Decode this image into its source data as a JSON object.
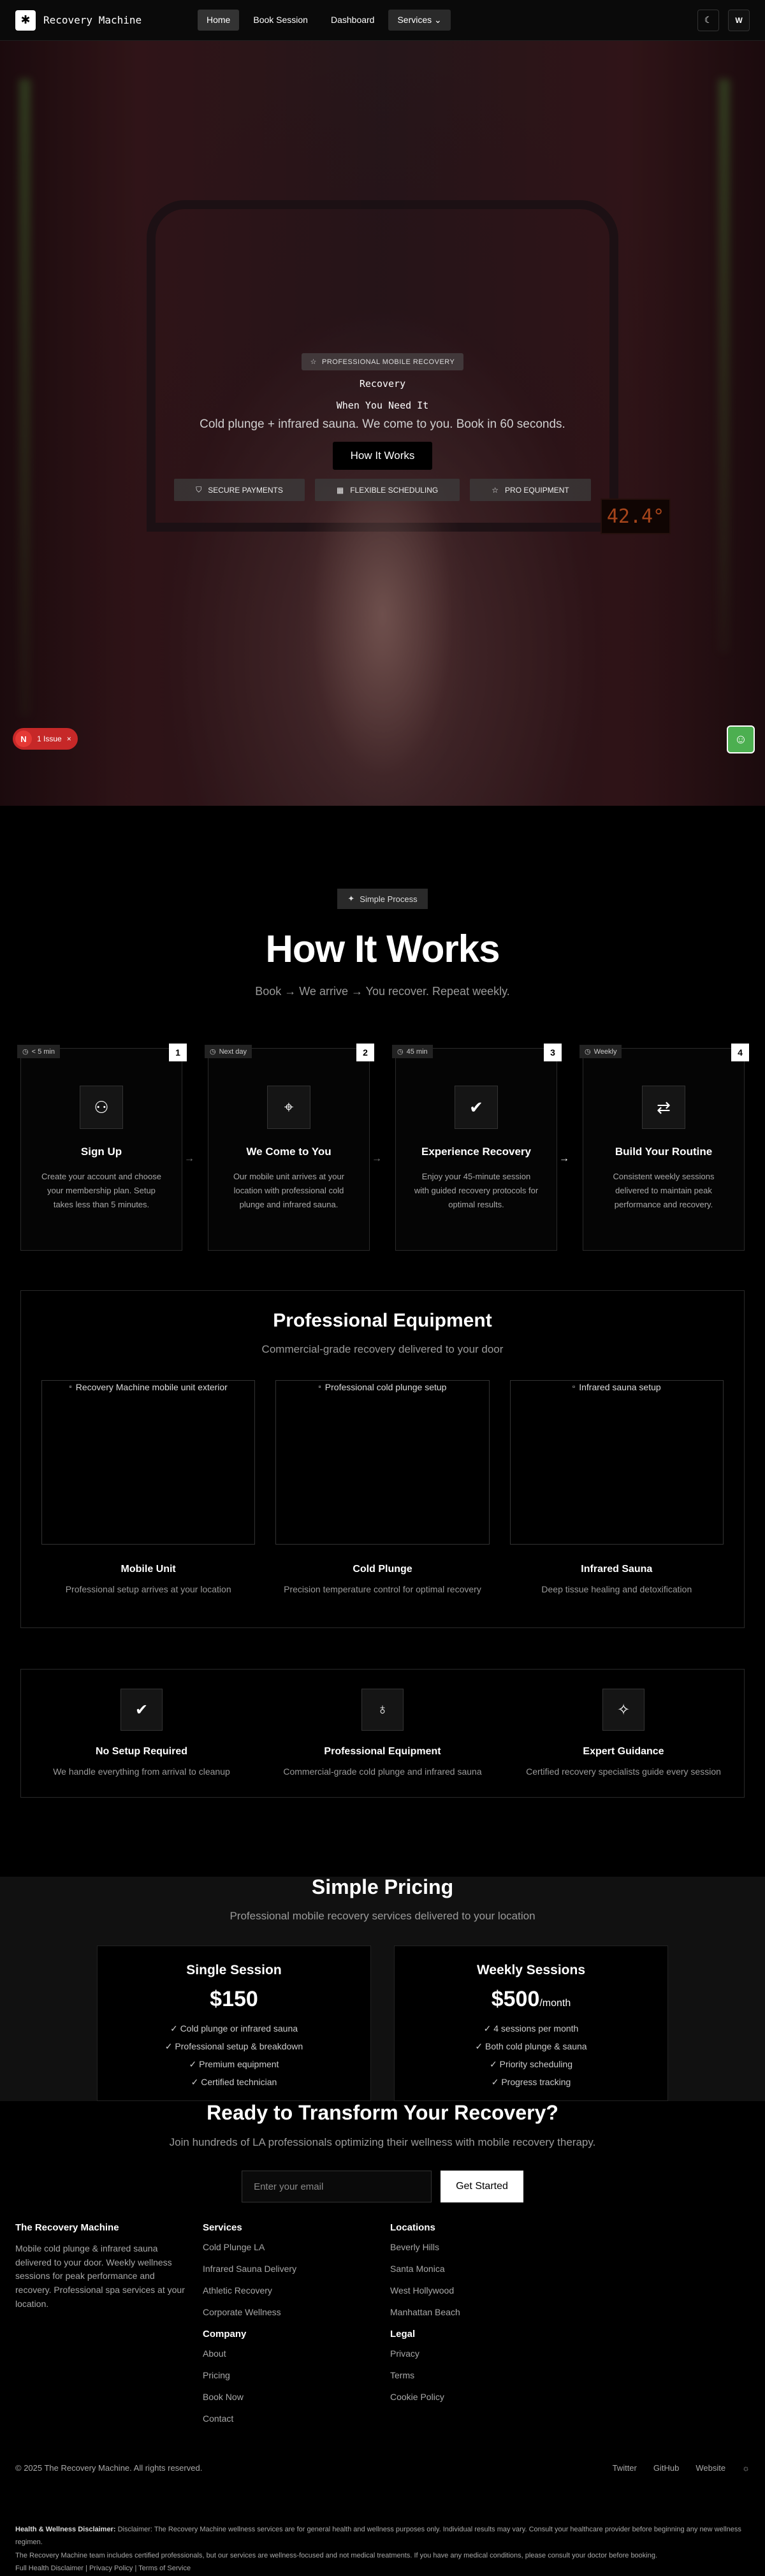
{
  "nav": {
    "brand": "Recovery Machine",
    "links": [
      "Home",
      "Book Session",
      "Dashboard"
    ],
    "services": "Services ⌄",
    "theme_icon": "moon-icon",
    "avatar": "W"
  },
  "hero": {
    "badge": "PROFESSIONAL MOBILE RECOVERY",
    "title": "Recovery",
    "subtitle": "When You Need It",
    "description": "Cold plunge + infrared sauna. We come to you. Book in 60 seconds.",
    "cta": "How It Works",
    "features": [
      "SECURE PAYMENTS",
      "FLEXIBLE SCHEDULING",
      "PRO EQUIPMENT"
    ],
    "thermo": "42.4°"
  },
  "issues": {
    "count_letter": "N",
    "label": "1 Issue",
    "close": "×"
  },
  "how": {
    "tag": "Simple Process",
    "title": "How It Works",
    "subtitle": "Book → We arrive → You recover. Repeat weekly.",
    "steps": [
      {
        "time": "< 5 min",
        "num": "1",
        "title": "Sign Up",
        "desc": "Create your account and choose your membership plan. Setup takes less than 5 minutes."
      },
      {
        "time": "Next day",
        "num": "2",
        "title": "We Come to You",
        "desc": "Our mobile unit arrives at your location with professional cold plunge and infrared sauna."
      },
      {
        "time": "45 min",
        "num": "3",
        "title": "Experience Recovery",
        "desc": "Enjoy your 45-minute session with guided recovery protocols for optimal results."
      },
      {
        "time": "Weekly",
        "num": "4",
        "title": "Build Your Routine",
        "desc": "Consistent weekly sessions delivered to maintain peak performance and recovery."
      }
    ]
  },
  "equipment": {
    "title": "Professional Equipment",
    "subtitle": "Commercial-grade recovery delivered to your door",
    "items": [
      {
        "alt": "Recovery Machine mobile unit exterior",
        "name": "Mobile Unit",
        "desc": "Professional setup arrives at your location"
      },
      {
        "alt": "Professional cold plunge setup",
        "name": "Cold Plunge",
        "desc": "Precision temperature control for optimal recovery"
      },
      {
        "alt": "Infrared sauna setup",
        "name": "Infrared Sauna",
        "desc": "Deep tissue healing and detoxification"
      }
    ]
  },
  "benefits": [
    {
      "title": "No Setup Required",
      "desc": "We handle everything from arrival to cleanup"
    },
    {
      "title": "Professional Equipment",
      "desc": "Commercial-grade cold plunge and infrared sauna"
    },
    {
      "title": "Expert Guidance",
      "desc": "Certified recovery specialists guide every session"
    }
  ],
  "pricing": {
    "title": "Simple Pricing",
    "subtitle": "Professional mobile recovery services delivered to your location",
    "plans": [
      {
        "name": "Single Session",
        "price": "$150",
        "per": "",
        "features": [
          "✓ Cold plunge or infrared sauna",
          "✓ Professional setup & breakdown",
          "✓ Premium equipment",
          "✓ Certified technician"
        ]
      },
      {
        "name": "Weekly Sessions",
        "price": "$500",
        "per": "/month",
        "features": [
          "✓ 4 sessions per month",
          "✓ Both cold plunge & sauna",
          "✓ Priority scheduling",
          "✓ Progress tracking"
        ]
      }
    ]
  },
  "cta": {
    "title": "Ready to Transform Your Recovery?",
    "subtitle": "Join hundreds of LA professionals optimizing their wellness with mobile recovery therapy.",
    "placeholder": "Enter your email",
    "button": "Get Started"
  },
  "footer": {
    "brand": "The Recovery Machine",
    "about": "Mobile cold plunge & infrared sauna delivered to your door. Weekly wellness sessions for peak performance and recovery. Professional spa services at your location.",
    "services_title": "Services",
    "services": [
      "Cold Plunge LA",
      "Infrared Sauna Delivery",
      "Athletic Recovery",
      "Corporate Wellness"
    ],
    "company_title": "Company",
    "company": [
      "About",
      "Pricing",
      "Book Now",
      "Contact"
    ],
    "locations_title": "Locations",
    "locations": [
      "Beverly Hills",
      "Santa Monica",
      "West Hollywood",
      "Manhattan Beach"
    ],
    "legal_title": "Legal",
    "legal": [
      "Privacy",
      "Terms",
      "Cookie Policy"
    ],
    "copyright": "© 2025 The Recovery Machine. All rights reserved.",
    "social": [
      "Twitter",
      "GitHub",
      "Website"
    ],
    "disclaimer_label": "Health & Wellness Disclaimer:",
    "disclaimer": "Disclaimer: The Recovery Machine wellness services are for general health and wellness purposes only. Individual results may vary. Consult your healthcare provider before beginning any new wellness regimen.",
    "disclaimer2": "The Recovery Machine team includes certified professionals, but our services are wellness-focused and not medical treatments. If you have any medical conditions, please consult your doctor before booking.",
    "disclaimer_links": "Full Health Disclaimer | Privacy Policy | Terms of Service"
  }
}
